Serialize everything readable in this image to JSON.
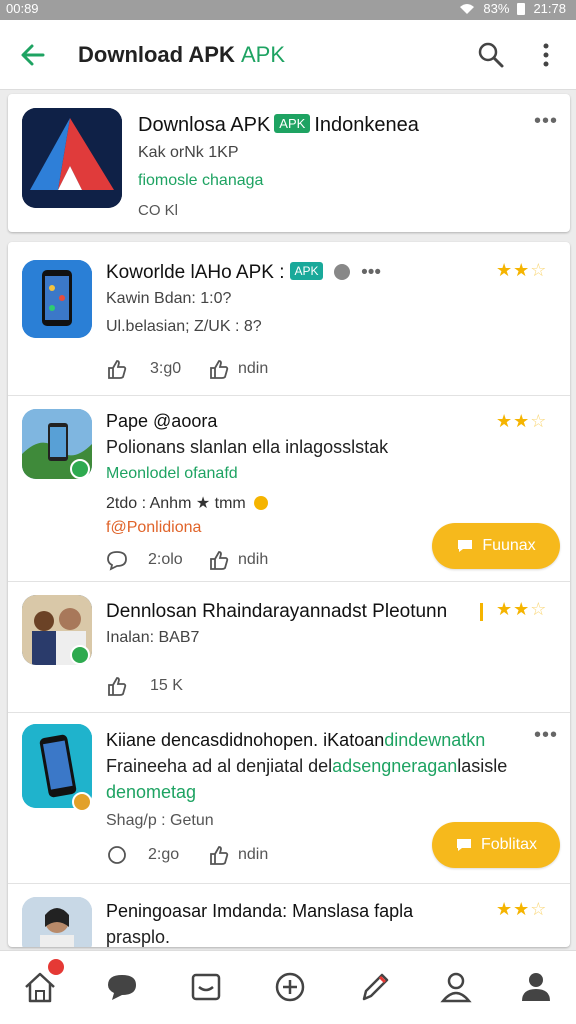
{
  "status": {
    "time_left": "00:89",
    "battery": "83%",
    "time_right": "21:78"
  },
  "appbar": {
    "title": "Download APK",
    "title_accent": "APK"
  },
  "featured": {
    "title": "Downlosa APK",
    "badge": "APK",
    "title_tail": "Indonkenea",
    "sub1": "Kak orNk 1KP",
    "sub2": "fiomosle chanaga",
    "sub3": "CO Kl"
  },
  "items": [
    {
      "title": "Koworlde lAHo APK :",
      "tag": "APK",
      "line1": "Kawin Bdan: 1:0?",
      "line2": "Ul.belasian; Z/UK : 8?",
      "like_count": "3:g0",
      "share_label": "ndin"
    },
    {
      "title": "Pape @aoora",
      "line1": "Polionans slanlan ella inlagosslstak",
      "line2": "Meonlodel ofanafd",
      "line3": "2tdo : Anhm ★ tmm",
      "line4": "f@Ponlidiona",
      "comment_count": "2:olo",
      "share_label": "ndih",
      "pill_label": "Fuunax"
    },
    {
      "title": "Dennlosan Rhaindarayannadst Pleotunn",
      "line1": "Inalan: BAB7",
      "like_count": "15 K"
    },
    {
      "title": "Kiiane dencasdidnohopen. iKatoan",
      "title_accent": "dindewnatkn",
      "line1_a": "Fraineeha ad al denjiatal del",
      "line1_b": "adsengneragan",
      "line1_c": "lasisle",
      "line2": "denometag",
      "line3": "Shag/p : Getun",
      "comment_count": "2:go",
      "share_label": "ndin",
      "pill_label": "Foblitax"
    },
    {
      "title": "Peningoasar Imdanda: Manslasa fapla",
      "line1": "prasplo."
    }
  ],
  "colors": {
    "accent_green": "#1ea362",
    "teal": "#19a99a",
    "star": "#f5b400",
    "pill": "#f6b91c"
  }
}
